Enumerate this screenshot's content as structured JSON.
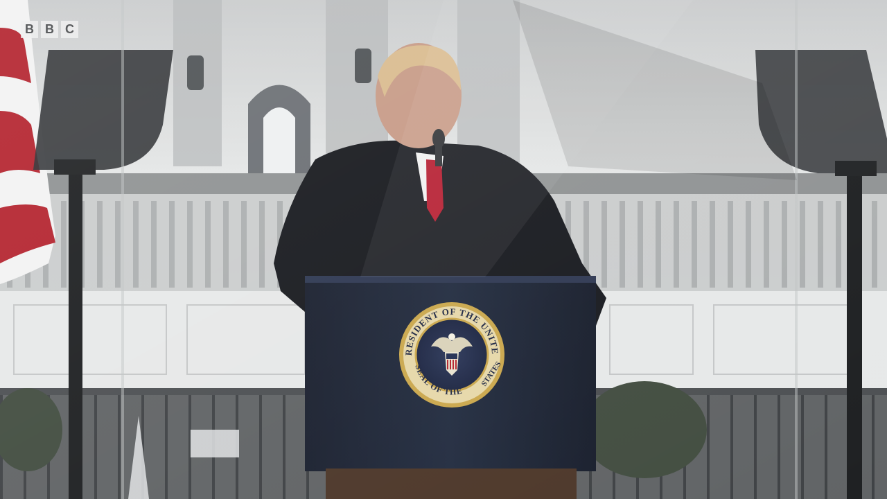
{
  "broadcaster_logo": {
    "letters": [
      "B",
      "B",
      "C"
    ]
  },
  "seal": {
    "top_text": "PRESIDENT OF THE UNITED",
    "bottom_text": "SEAL OF THE",
    "right_text": "STATES"
  },
  "colors": {
    "podium_navy": "#1b2233",
    "seal_gold": "#c9a64a",
    "suit_dark": "#15171c",
    "tie_red": "#b3162a",
    "building_white": "#e8eaea",
    "flag_red": "#b3212c"
  }
}
